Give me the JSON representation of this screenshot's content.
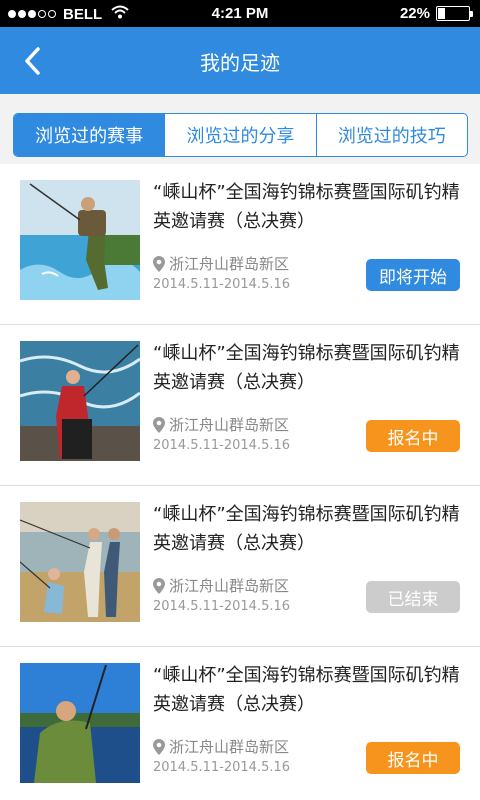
{
  "status_bar": {
    "carrier": "BELL",
    "time": "4:21 PM",
    "battery": "22%",
    "battery_level": 0.22
  },
  "nav": {
    "title": "我的足迹",
    "back_icon": "chevron-left-icon"
  },
  "tabs": [
    {
      "label": "浏览过的赛事",
      "active": true
    },
    {
      "label": "浏览过的分享",
      "active": false
    },
    {
      "label": "浏览过的技巧",
      "active": false
    }
  ],
  "events": [
    {
      "title": "“嵊山杯”全国海钓锦标赛暨国际矶钓精英邀请赛（总决赛）",
      "location": "浙江舟山群岛新区",
      "dates": "2014.5.11-2014.5.16",
      "status": "即将开始",
      "status_color": "#2f8ae0"
    },
    {
      "title": "“嵊山杯”全国海钓锦标赛暨国际矶钓精英邀请赛（总决赛）",
      "location": "浙江舟山群岛新区",
      "dates": "2014.5.11-2014.5.16",
      "status": "报名中",
      "status_color": "#f7941d"
    },
    {
      "title": "“嵊山杯”全国海钓锦标赛暨国际矶钓精英邀请赛（总决赛）",
      "location": "浙江舟山群岛新区",
      "dates": "2014.5.11-2014.5.16",
      "status": "已结束",
      "status_color": "#cccccc"
    },
    {
      "title": "“嵊山杯”全国海钓锦标赛暨国际矶钓精英邀请赛（总决赛）",
      "location": "浙江舟山群岛新区",
      "dates": "2014.5.11-2014.5.16",
      "status": "报名中",
      "status_color": "#f7941d"
    }
  ]
}
